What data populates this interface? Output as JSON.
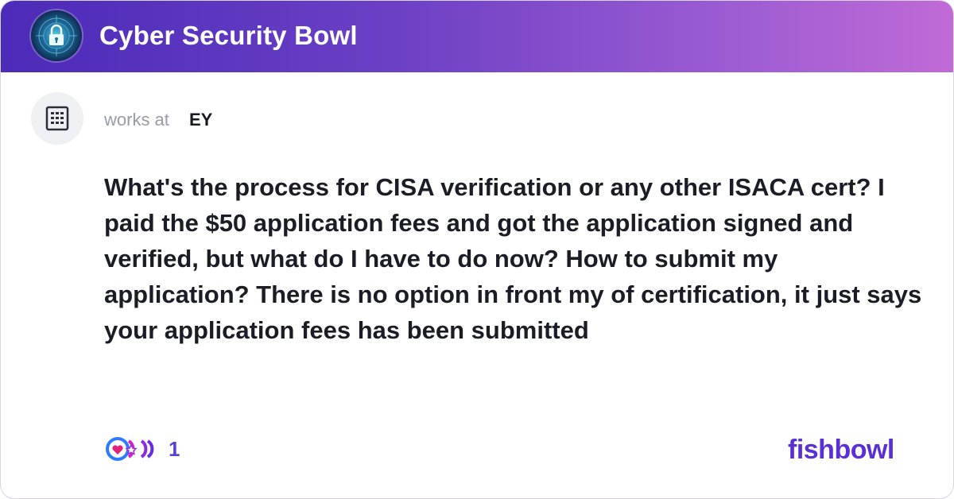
{
  "header": {
    "title": "Cyber Security Bowl",
    "logo_icon": "padlock-circuit-icon",
    "gradient_colors": [
      "#4b2bb8",
      "#c06ad6"
    ]
  },
  "author": {
    "avatar_icon": "building-icon",
    "works_at_label": "works at",
    "company": "EY"
  },
  "post": {
    "text": "What's the process for CISA verification or any other ISACA cert? I paid the $50 application fees and got the application signed and verified, but what do I have to do now? How to submit my application? There is no option in front my of certification, it just says your application fees has been submitted"
  },
  "footer": {
    "reaction_icons": [
      "heart-reaction-icon",
      "star-reaction-icon",
      "bracket-reaction-icon"
    ],
    "reaction_count": "1",
    "brand": "fishbowl",
    "brand_color": "#5a2fd6"
  }
}
